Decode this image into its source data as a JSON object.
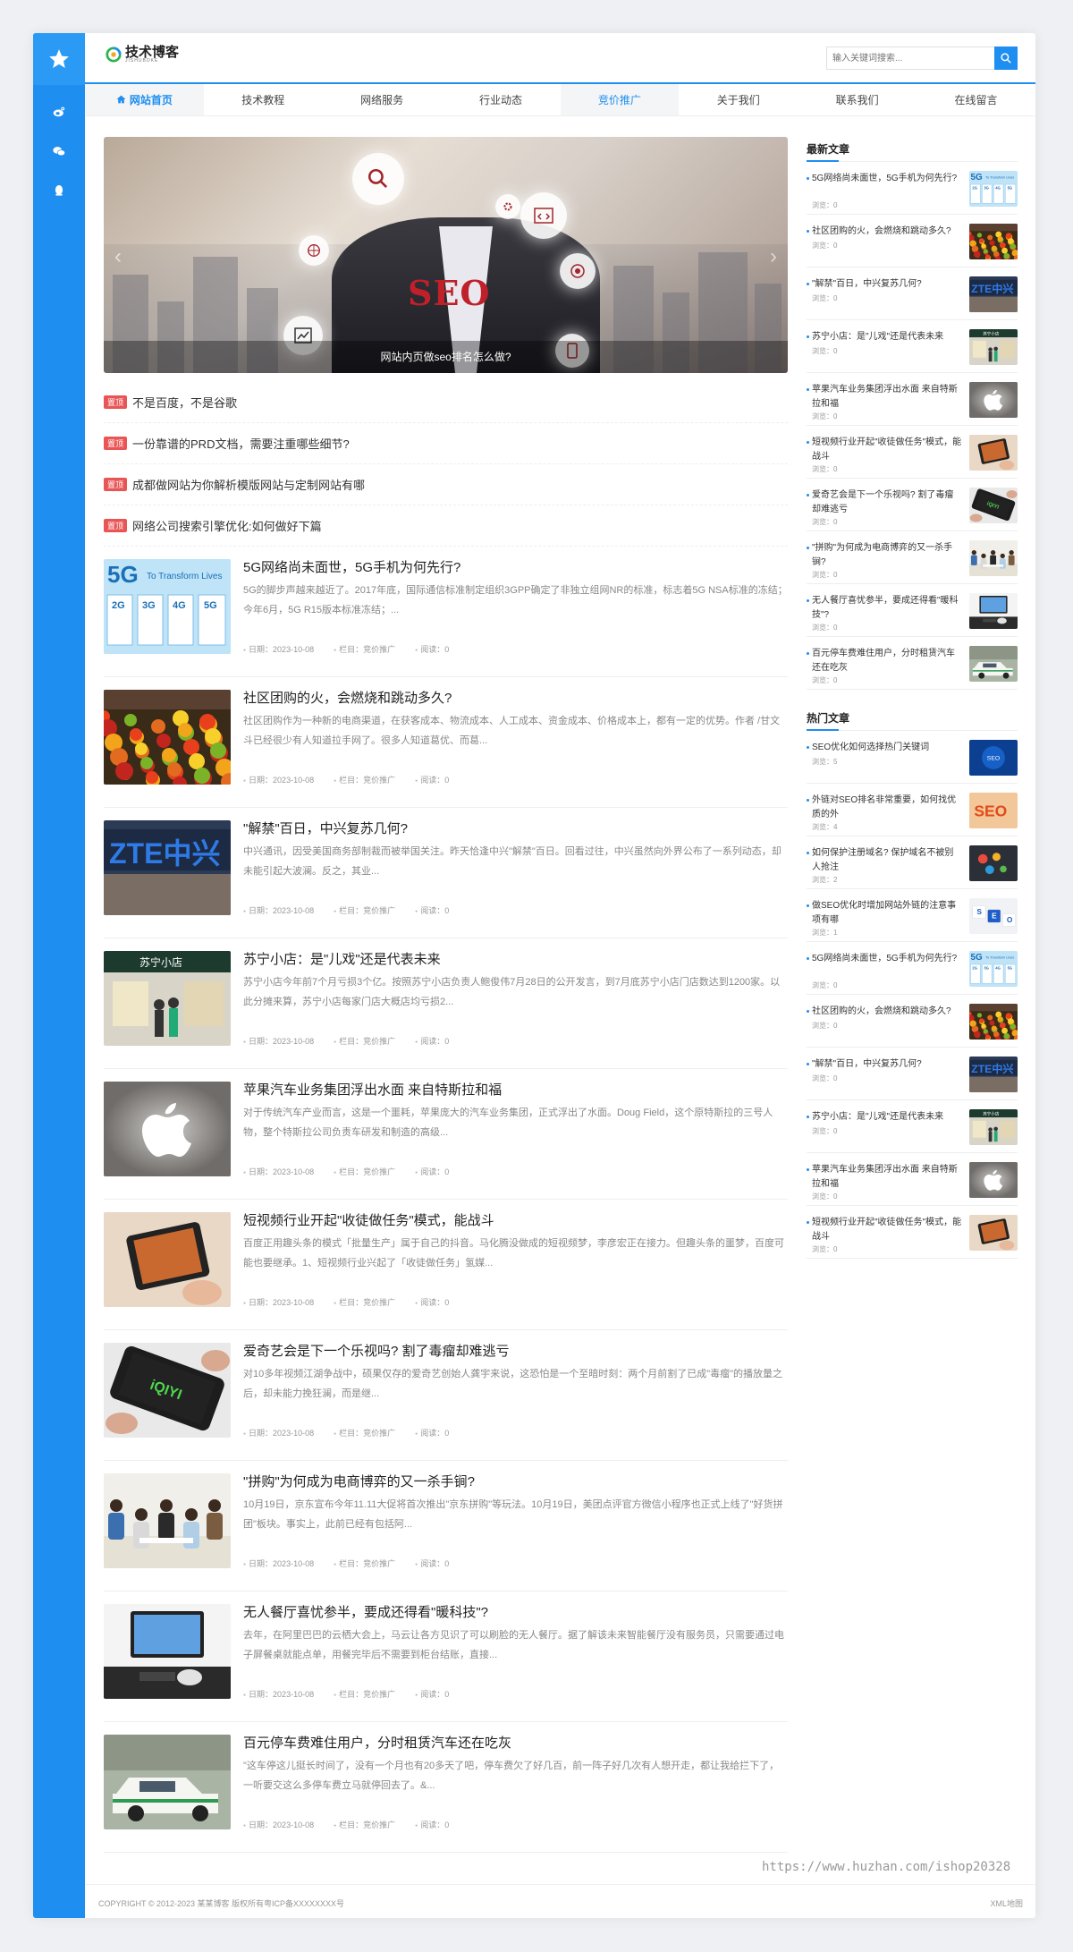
{
  "site": {
    "logo_text": "技术博客",
    "logo_sub": "JISHUBOKE"
  },
  "search": {
    "placeholder": "输入关键词搜索..."
  },
  "nav": [
    "网站首页",
    "技术教程",
    "网络服务",
    "行业动态",
    "竞价推广",
    "关于我们",
    "联系我们",
    "在线留言"
  ],
  "banner": {
    "caption": "网站内页做seo排名怎么做?",
    "seo": "SEO"
  },
  "top_label": "置顶",
  "top_posts": [
    "不是百度，不是谷歌",
    "一份靠谱的PRD文档，需要注重哪些细节?",
    "成都做网站为你解析模版网站与定制网站有哪",
    "网络公司搜索引擎优化:如何做好下篇"
  ],
  "meta_labels": {
    "date": "日期：",
    "column": "栏目：",
    "reads": "阅读："
  },
  "articles": [
    {
      "title": "5G网络尚未面世，5G手机为何先行?",
      "desc": "5G的脚步声越来越近了。2017年底，国际通信标准制定组织3GPP确定了非独立组网NR的标准，标志着5G NSA标准的冻结；今年6月，5G R15版本标准冻结；...",
      "date": "2023-10-08",
      "column": "竞价推广",
      "reads": "0",
      "thumb": "5g"
    },
    {
      "title": "社区团购的火，会燃烧和跳动多久?",
      "desc": "社区团购作为一种新的电商渠道，在获客成本、物流成本、人工成本、资金成本、价格成本上，都有一定的优势。作者 /甘文斗已经很少有人知道拉手网了。很多人知道葛优、而葛...",
      "date": "2023-10-08",
      "column": "竞价推广",
      "reads": "0",
      "thumb": "fruit"
    },
    {
      "title": "\"解禁\"百日，中兴复苏几何?",
      "desc": "中兴通讯，因受美国商务部制裁而被举国关注。昨天恰逢中兴\"解禁\"百日。回看过往，中兴虽然向外界公布了一系列动态，却未能引起大波澜。反之，其业...",
      "date": "2023-10-08",
      "column": "竞价推广",
      "reads": "0",
      "thumb": "zte"
    },
    {
      "title": "苏宁小店：是\"儿戏\"还是代表未来",
      "desc": "苏宁小店今年前7个月亏损3个亿。按照苏宁小店负责人鲍俊伟7月28日的公开发言，到7月底苏宁小店门店数达到1200家。以此分摊来算，苏宁小店每家门店大概店均亏损2...",
      "date": "2023-10-08",
      "column": "竞价推广",
      "reads": "0",
      "thumb": "store"
    },
    {
      "title": "苹果汽车业务集团浮出水面 来自特斯拉和福",
      "desc": "对于传统汽车产业而言，这是一个噩耗，苹果庞大的汽车业务集团，正式浮出了水面。Doug Field，这个原特斯拉的三号人物，整个特斯拉公司负责车研发和制造的高级...",
      "date": "2023-10-08",
      "column": "竞价推广",
      "reads": "0",
      "thumb": "apple"
    },
    {
      "title": "短视频行业开起\"收徒做任务\"模式，能战斗",
      "desc": "百度正用趣头条的模式「批量生产」属于自己的抖音。马化腾没做成的短视频梦，李彦宏正在接力。但趣头条的噩梦，百度可能也要继承。1、短视频行业兴起了「收徒做任务」氢媒...",
      "date": "2023-10-08",
      "column": "竞价推广",
      "reads": "0",
      "thumb": "phone"
    },
    {
      "title": "爱奇艺会是下一个乐视吗? 割了毒瘤却难逃亏",
      "desc": "对10多年视频江湖争战中，硕果仅存的爱奇艺创始人龚宇来说，这恐怕是一个至暗时刻：两个月前割了已成\"毒瘤\"的播放量之后，却未能力挽狂澜，而是继...",
      "date": "2023-10-08",
      "column": "竞价推广",
      "reads": "0",
      "thumb": "iqiyi"
    },
    {
      "title": "\"拼购\"为何成为电商博弈的又一杀手锏?",
      "desc": "10月19日，京东宣布今年11.11大促将首次推出\"京东拼购\"等玩法。10月19日，美团点评官方微信小程序也正式上线了\"好货拼团\"板块。事实上，此前已经有包括阿...",
      "date": "2023-10-08",
      "column": "竞价推广",
      "reads": "0",
      "thumb": "office"
    },
    {
      "title": "无人餐厅喜忧参半，要成还得看\"暖科技\"?",
      "desc": "去年，在阿里巴巴的云栖大会上，马云让各方见识了可以刷脸的无人餐厅。据了解该未来智能餐厅没有服务员，只需要通过电子屏餐桌就能点单，用餐完毕后不需要到柜台结账，直接...",
      "date": "2023-10-08",
      "column": "竞价推广",
      "reads": "0",
      "thumb": "desk"
    },
    {
      "title": "百元停车费难住用户，分时租赁汽车还在吃灰",
      "desc": "\"这车停这儿挺长时间了，没有一个月也有20多天了吧，停车费欠了好几百，前一阵子好几次有人想开走，都让我给拦下了，一听要交这么多停车费立马就停回去了。&...",
      "date": "2023-10-08",
      "column": "竞价推广",
      "reads": "0",
      "thumb": "car"
    }
  ],
  "sidebar": {
    "latest_title": "最新文章",
    "views_label": "浏览：",
    "latest": [
      {
        "title": "5G网络尚未面世，5G手机为何先行?",
        "views": "0",
        "thumb": "5g"
      },
      {
        "title": "社区团购的火，会燃烧和跳动多久?",
        "views": "0",
        "thumb": "fruit"
      },
      {
        "title": "\"解禁\"百日，中兴复苏几何?",
        "views": "0",
        "thumb": "zte"
      },
      {
        "title": "苏宁小店：是\"儿戏\"还是代表未来",
        "views": "0",
        "thumb": "store"
      },
      {
        "title": "苹果汽车业务集团浮出水面 来自特斯拉和福",
        "views": "0",
        "thumb": "apple"
      },
      {
        "title": "短视频行业开起\"收徒做任务\"模式，能战斗",
        "views": "0",
        "thumb": "phone"
      },
      {
        "title": "爱奇艺会是下一个乐视吗? 割了毒瘤却难逃亏",
        "views": "0",
        "thumb": "iqiyi"
      },
      {
        "title": "\"拼购\"为何成为电商博弈的又一杀手锏?",
        "views": "0",
        "thumb": "office"
      },
      {
        "title": "无人餐厅喜忧参半，要成还得看\"暖科技\"?",
        "views": "0",
        "thumb": "desk"
      },
      {
        "title": "百元停车费难住用户，分时租赁汽车还在吃灰",
        "views": "0",
        "thumb": "car"
      }
    ],
    "hot_title": "热门文章",
    "hot": [
      {
        "title": "SEO优化如何选择热门关键词",
        "views": "5",
        "thumb": "seoblue"
      },
      {
        "title": "外链对SEO排名非常重要，如何找优质的外",
        "views": "4",
        "thumb": "seoorange"
      },
      {
        "title": "如何保护注册域名? 保护域名不被别人抢注",
        "views": "2",
        "thumb": "dots"
      },
      {
        "title": "做SEO优化时增加网站外链的注意事项有哪",
        "views": "1",
        "thumb": "keys"
      },
      {
        "title": "5G网络尚未面世，5G手机为何先行?",
        "views": "0",
        "thumb": "5g"
      },
      {
        "title": "社区团购的火，会燃烧和跳动多久?",
        "views": "0",
        "thumb": "fruit"
      },
      {
        "title": "\"解禁\"百日，中兴复苏几何?",
        "views": "0",
        "thumb": "zte"
      },
      {
        "title": "苏宁小店：是\"儿戏\"还是代表未来",
        "views": "0",
        "thumb": "store"
      },
      {
        "title": "苹果汽车业务集团浮出水面 来自特斯拉和福",
        "views": "0",
        "thumb": "apple"
      },
      {
        "title": "短视频行业开起\"收徒做任务\"模式，能战斗",
        "views": "0",
        "thumb": "phone"
      }
    ]
  },
  "footer": {
    "copyright": "COPYRIGHT © 2012-2023 某某博客 版权所有粤ICP备XXXXXXXX号",
    "xml": "XML地图"
  },
  "watermark": "https://www.huzhan.com/ishop20328",
  "colors": {
    "accent": "#1e8ef0",
    "badge": "#e95555"
  }
}
